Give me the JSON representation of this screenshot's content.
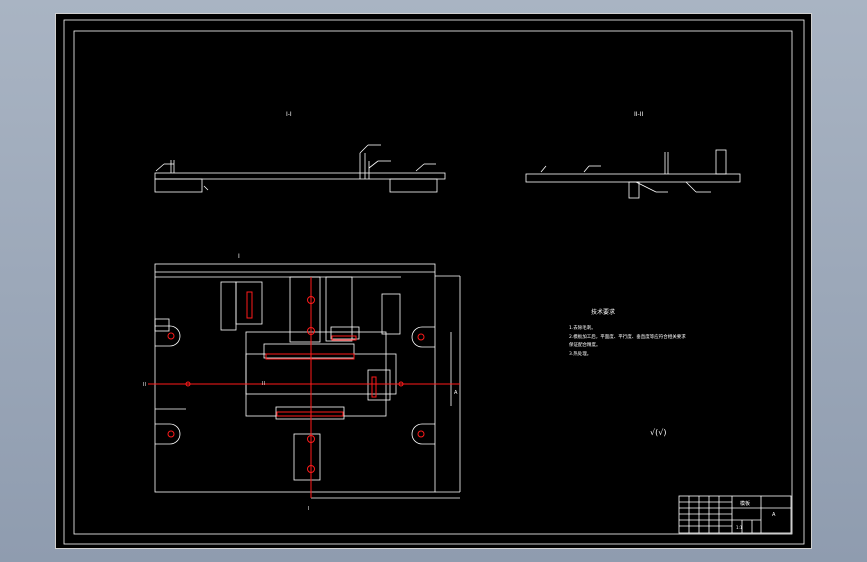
{
  "drawing": {
    "view_labels": {
      "left_view": "I-I",
      "right_view": "II-II",
      "plan_view": "I"
    },
    "section_marks": {
      "top": "I",
      "left": "II",
      "middle": "II",
      "right": "A",
      "bottom": "I"
    },
    "notes": {
      "title": "技术要求",
      "items": [
        "1.去除毛刺。",
        "2.模板加工后，平面度、平行度、垂直度等应符合相关要求",
        "保证配合精度。",
        "3.热处理。"
      ]
    },
    "roughness_symbol": "√(√)",
    "title_block": {
      "part_name": "模板",
      "scale": "1:1",
      "drawing_no": "A"
    }
  },
  "colors": {
    "background": "#000000",
    "lines": "#ffffff",
    "centerlines": "#ff1a1a",
    "frame_bg": "#9aa6b7"
  }
}
